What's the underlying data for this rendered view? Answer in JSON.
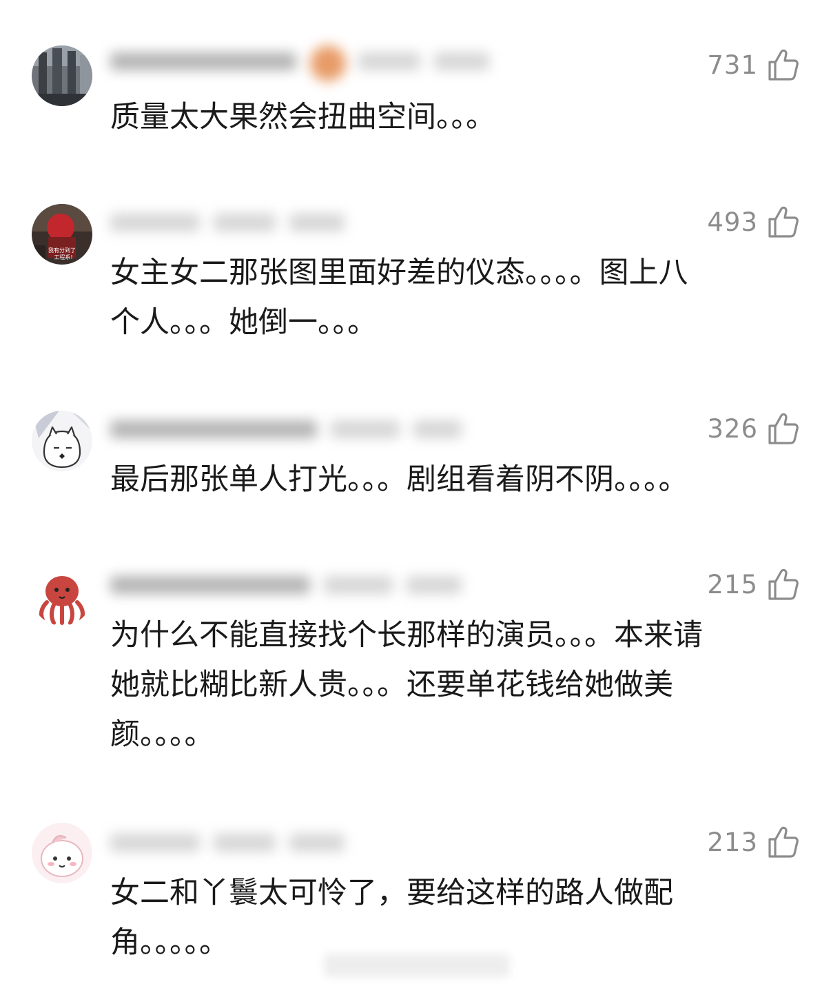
{
  "comments": [
    {
      "likes": "731",
      "text": "质量太大果然会扭曲空间。。。"
    },
    {
      "likes": "493",
      "text": "女主女二那张图里面好差的仪态。。。。图上八\n个人。。。她倒一。。。",
      "avatar_caption_1": "我有分到了",
      "avatar_caption_2": "工程系!"
    },
    {
      "likes": "326",
      "text": "最后那张单人打光。。。剧组看着阴不阴。。。。"
    },
    {
      "likes": "215",
      "text": "为什么不能直接找个长那样的演员。。。本来请\n她就比糊比新人贵。。。还要单花钱给她做美\n颜。。。。"
    },
    {
      "likes": "213",
      "text": "女二和丫鬟太可怜了，要给这样的路人做配\n角。。。。。"
    }
  ],
  "colors": {
    "text": "#1a1a1a",
    "like_count": "#8c8c8c",
    "background": "#ffffff"
  },
  "icons": {
    "like": "thumbs-up-outline-icon"
  }
}
